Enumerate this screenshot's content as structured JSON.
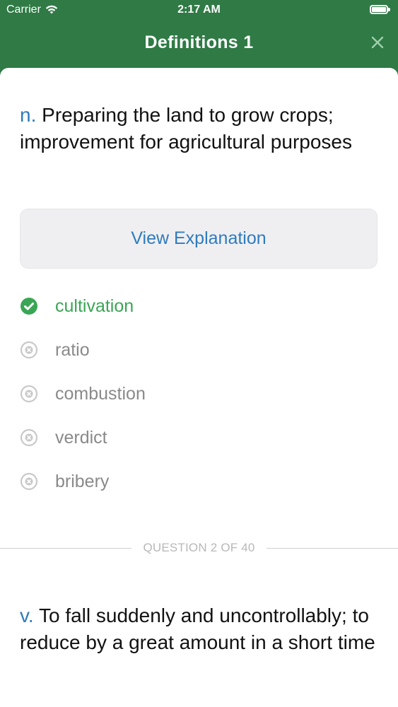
{
  "status_bar": {
    "carrier": "Carrier",
    "time": "2:17 AM"
  },
  "nav": {
    "title": "Definitions 1",
    "close_icon": "close-icon"
  },
  "colors": {
    "nav_background": "#2f7a45",
    "accent_blue": "#2f7bbf",
    "correct_green": "#3aa655",
    "neutral_gray": "#8a8a8a"
  },
  "question_1": {
    "part_of_speech": "n.",
    "definition": " Preparing the land to grow crops; improvement for agricultural purposes"
  },
  "explanation_button": {
    "label": "View Explanation"
  },
  "answers": [
    {
      "label": "cultivation",
      "state": "correct",
      "icon": "check-circle-icon"
    },
    {
      "label": "ratio",
      "state": "incorrect",
      "icon": "x-circle-icon"
    },
    {
      "label": "combustion",
      "state": "incorrect",
      "icon": "x-circle-icon"
    },
    {
      "label": "verdict",
      "state": "incorrect",
      "icon": "x-circle-icon"
    },
    {
      "label": "bribery",
      "state": "incorrect",
      "icon": "x-circle-icon"
    }
  ],
  "progress": {
    "label": "QUESTION 2 OF 40"
  },
  "question_2": {
    "part_of_speech": "v.",
    "definition": " To fall suddenly and uncontrollably; to reduce by a great amount in a short time"
  }
}
